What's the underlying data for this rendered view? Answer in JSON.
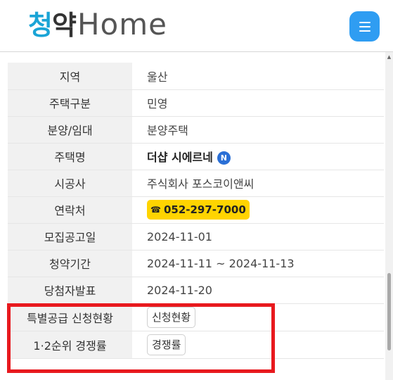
{
  "header": {
    "logo_ko_1": "청",
    "logo_ko_2": "약",
    "logo_en": "Home",
    "menu_icon": "hamburger-icon"
  },
  "rows": [
    {
      "label": "지역",
      "value": "울산"
    },
    {
      "label": "주택구분",
      "value": "민영"
    },
    {
      "label": "분양/임대",
      "value": "분양주택"
    },
    {
      "label": "주택명",
      "value": "더샵 시에르네",
      "badge": "N"
    },
    {
      "label": "시공사",
      "value": "주식회사 포스코이앤씨"
    },
    {
      "label": "연락처",
      "value": "052-297-7000",
      "icon": "phone-icon"
    },
    {
      "label": "모집공고일",
      "value": "2024-11-01"
    },
    {
      "label": "청약기간",
      "value": "2024-11-11 ~ 2024-11-13"
    },
    {
      "label": "당첨자발표",
      "value": "2024-11-20"
    },
    {
      "label": "특별공급 신청현황",
      "button": "신청현황"
    },
    {
      "label": "1·2순위 경쟁률",
      "button": "경쟁률"
    }
  ],
  "colors": {
    "accent": "#2f9df2",
    "logo_blue": "#1aa4d6",
    "phone_bg": "#ffd400",
    "badge_blue": "#2a6fd6",
    "highlight_red": "#e8191e"
  }
}
